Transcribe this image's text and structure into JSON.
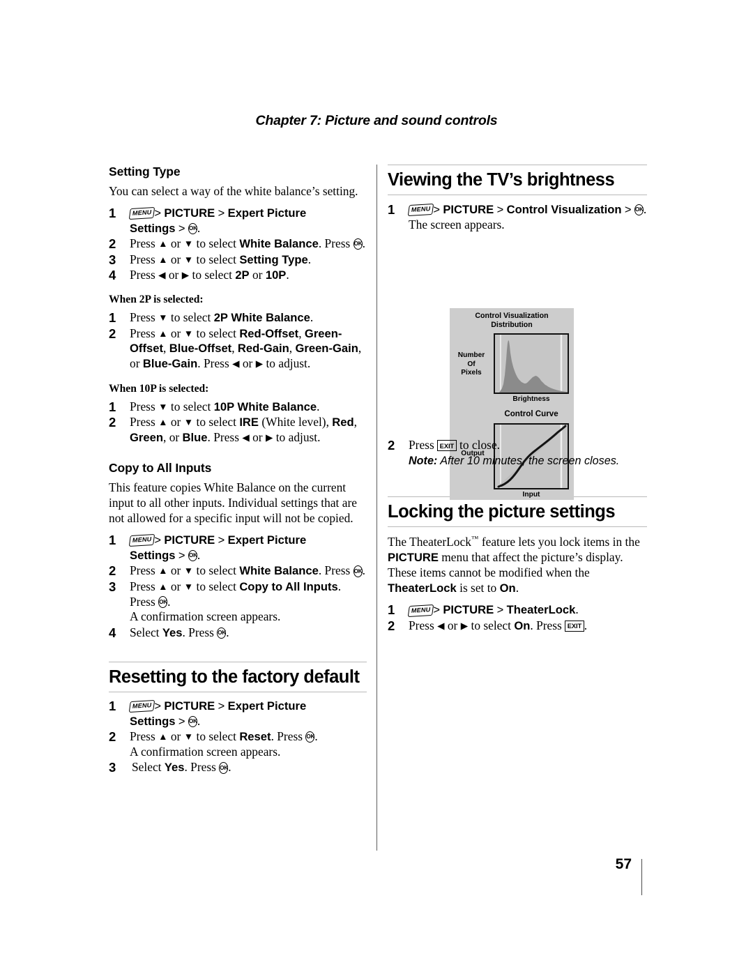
{
  "running_head": "Chapter 7: Picture and sound controls",
  "page_number": "57",
  "icons": {
    "menu": "MENU",
    "ok": "OK",
    "exit": "EXIT",
    "up": "▲",
    "down": "▼",
    "left": "◀",
    "right": "▶",
    "gt": ">"
  },
  "left_column": {
    "setting_type": {
      "heading": "Setting Type",
      "intro": "You can select a way of the white balance’s setting.",
      "steps": [
        {
          "num": "1",
          "parts": [
            "MENU",
            " > ",
            "PICTURE",
            " > ",
            "Expert Picture Settings",
            " > ",
            "OK",
            "."
          ]
        },
        {
          "num": "2",
          "text_a": "Press ",
          "text_b": " or ",
          "text_c": " to select ",
          "bold": "White Balance",
          "text_d": ". Press ",
          "text_e": "."
        },
        {
          "num": "3",
          "text_a": "Press ",
          "text_b": " or ",
          "text_c": " to select ",
          "bold": "Setting Type",
          "text_d": "."
        },
        {
          "num": "4",
          "text_a": "Press ",
          "text_b": " or ",
          "text_c": " to select ",
          "bold": "2P",
          "text_d": " or ",
          "bold2": "10P",
          "text_e": "."
        }
      ],
      "cond_2p": "When 2P is selected:",
      "steps_2p": [
        {
          "num": "1",
          "text_a": "Press ",
          "text_b": " to select ",
          "bold": "2P White Balance",
          "text_c": "."
        },
        {
          "num": "2",
          "text_a": "Press ",
          "text_b": " or ",
          "text_c": " to select ",
          "b1": "Red-Offset",
          "s1": ", ",
          "b2": "Green-Offset",
          "s2": ", ",
          "b3": "Blue-Offset",
          "s3": ", ",
          "b4": "Red-Gain",
          "s4": ", ",
          "b5": "Green-Gain",
          "s5": ", or ",
          "b6": "Blue-Gain",
          "s6": ". Press ",
          "s7": " or ",
          "s8": " to adjust."
        }
      ],
      "cond_10p": "When 10P is selected:",
      "steps_10p": [
        {
          "num": "1",
          "text_a": "Press ",
          "text_b": " to select ",
          "bold": "10P White Balance",
          "text_c": "."
        },
        {
          "num": "2",
          "text_a": "Press ",
          "text_b": " or ",
          "text_c": " to select ",
          "b1": "IRE",
          "s1": " (White level), ",
          "b2": "Red",
          "s2": ", ",
          "b3": "Green",
          "s3": ", or ",
          "b4": "Blue",
          "s4": ". Press ",
          "s5": " or ",
          "s6": " to adjust."
        }
      ]
    },
    "copy_to_all_inputs": {
      "heading": "Copy to All Inputs",
      "intro": "This feature copies White Balance on the current input to all other inputs. Individual settings that are not allowed for a specific input will not be copied.",
      "steps": [
        {
          "num": "1"
        },
        {
          "num": "2",
          "bold": "White Balance"
        },
        {
          "num": "3",
          "bold": "Copy to All Inputs",
          "sub": "A confirmation screen appears."
        },
        {
          "num": "4",
          "text_a": "Select ",
          "bold": "Yes",
          "text_b": ". Press ",
          "text_c": "."
        }
      ]
    },
    "resetting": {
      "heading": "Resetting to the factory default",
      "steps": [
        {
          "num": "1"
        },
        {
          "num": "2",
          "bold": "Reset",
          "sub": "A confirmation screen appears."
        },
        {
          "num": "3",
          "text_a": "Select ",
          "bold": "Yes",
          "text_b": ". Press ",
          "text_c": "."
        }
      ]
    }
  },
  "right_column": {
    "viewing_brightness": {
      "heading": "Viewing the TV’s brightness",
      "step1_bold": "Control Visualization",
      "step1_tail": ". The screen appears.",
      "step2_a": "Press ",
      "step2_b": " to close.",
      "note_label": "Note:",
      "note_text": " After 10 minutes, the screen closes."
    },
    "figure": {
      "title_line1": "Control Visualization",
      "title_line2": "Distribution",
      "hist_y_label_l1": "Number",
      "hist_y_label_l2": "Of",
      "hist_y_label_l3": "Pixels",
      "hist_x_label": "Brightness",
      "curve_title": "Control Curve",
      "curve_y_label": "Output",
      "curve_x_label": "Input"
    },
    "locking": {
      "heading": "Locking the picture settings",
      "intro_a": "The TheaterLock",
      "intro_tm": "™",
      "intro_b": " feature lets you lock items in the ",
      "intro_bold1": "PICTURE",
      "intro_c": " menu that affect the picture’s display.  These items cannot be modified when the ",
      "intro_bold2": "TheaterLock",
      "intro_d": " is set to ",
      "intro_bold3": "On",
      "intro_e": ".",
      "steps": [
        {
          "num": "1",
          "bold": "TheaterLock"
        },
        {
          "num": "2",
          "text_a": "Press ",
          "text_b": " or ",
          "text_c": " to select ",
          "bold": "On",
          "text_d": ". Press ",
          "text_e": "."
        }
      ]
    }
  },
  "common": {
    "press": "Press ",
    "or": " or ",
    "to_select": " to select ",
    "to_adjust": " to adjust.",
    "period": ".",
    "picture": "PICTURE",
    "expert_picture_settings": "Expert Picture Settings",
    "press_dot": ". Press ",
    "select": "Select ",
    "yes": "Yes"
  },
  "chart_data": {
    "type": "area",
    "title": "Control Visualization",
    "panels": [
      {
        "name": "Distribution",
        "type": "area",
        "xlabel": "Brightness",
        "ylabel": "Number Of Pixels",
        "x": [
          0,
          4,
          8,
          12,
          16,
          20,
          24,
          28,
          32,
          36,
          40,
          44,
          48,
          52,
          56,
          60,
          64,
          68,
          72,
          76,
          80,
          84,
          88,
          92,
          96,
          100
        ],
        "values": [
          3,
          6,
          14,
          42,
          86,
          97,
          74,
          55,
          42,
          33,
          27,
          22,
          19,
          17,
          18,
          24,
          31,
          34,
          32,
          26,
          21,
          17,
          14,
          11,
          9,
          7
        ]
      },
      {
        "name": "Control Curve",
        "type": "line",
        "xlabel": "Input",
        "ylabel": "Output",
        "x": [
          0,
          10,
          20,
          30,
          40,
          50,
          60,
          70,
          80,
          90,
          100
        ],
        "values": [
          0,
          5,
          13,
          24,
          38,
          53,
          66,
          75,
          82,
          90,
          100
        ],
        "reference_line": {
          "name": "identity",
          "x": [
            0,
            100
          ],
          "values": [
            0,
            100
          ]
        }
      }
    ]
  }
}
